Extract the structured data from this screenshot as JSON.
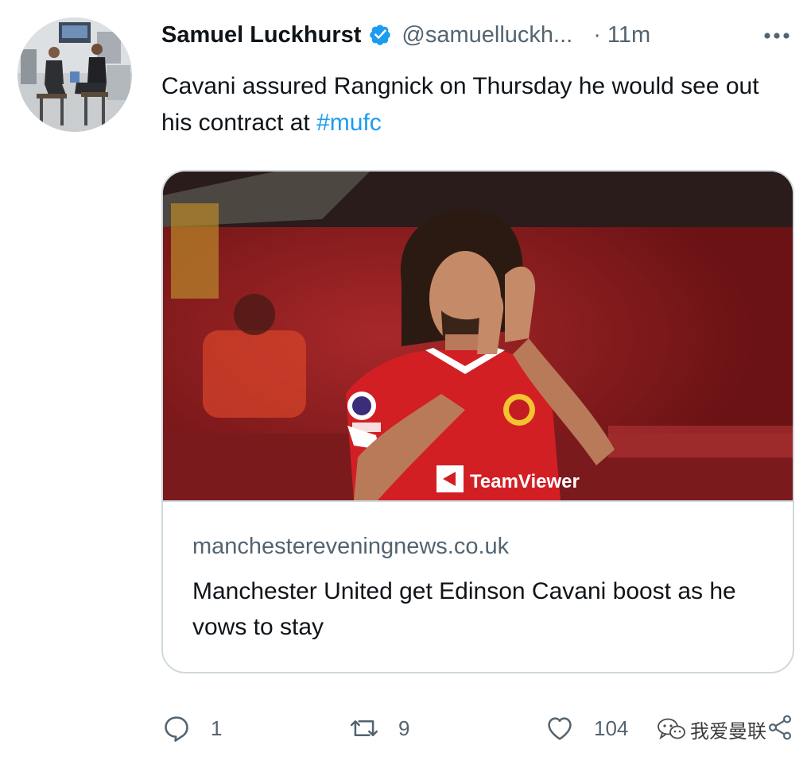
{
  "author": {
    "display_name": "Samuel Luckhurst",
    "handle": "@samuelluckh...",
    "separator": "·",
    "time": "11m"
  },
  "tweet": {
    "text_before": "Cavani assured Rangnick on Thursday he would see out his contract at ",
    "hashtag": "#mufc"
  },
  "card": {
    "domain": "manchestereveningnews.co.uk",
    "title": "Manchester United get Edinson Cavani boost as he vows to stay",
    "shirt_sponsor": "TeamViewer"
  },
  "actions": {
    "reply_count": "1",
    "retweet_count": "9",
    "like_count": "104"
  },
  "watermark": {
    "text": "我爱曼联"
  },
  "colors": {
    "accent": "#1d9bf0",
    "secondary_text": "#536471",
    "border": "#cfd9de"
  }
}
